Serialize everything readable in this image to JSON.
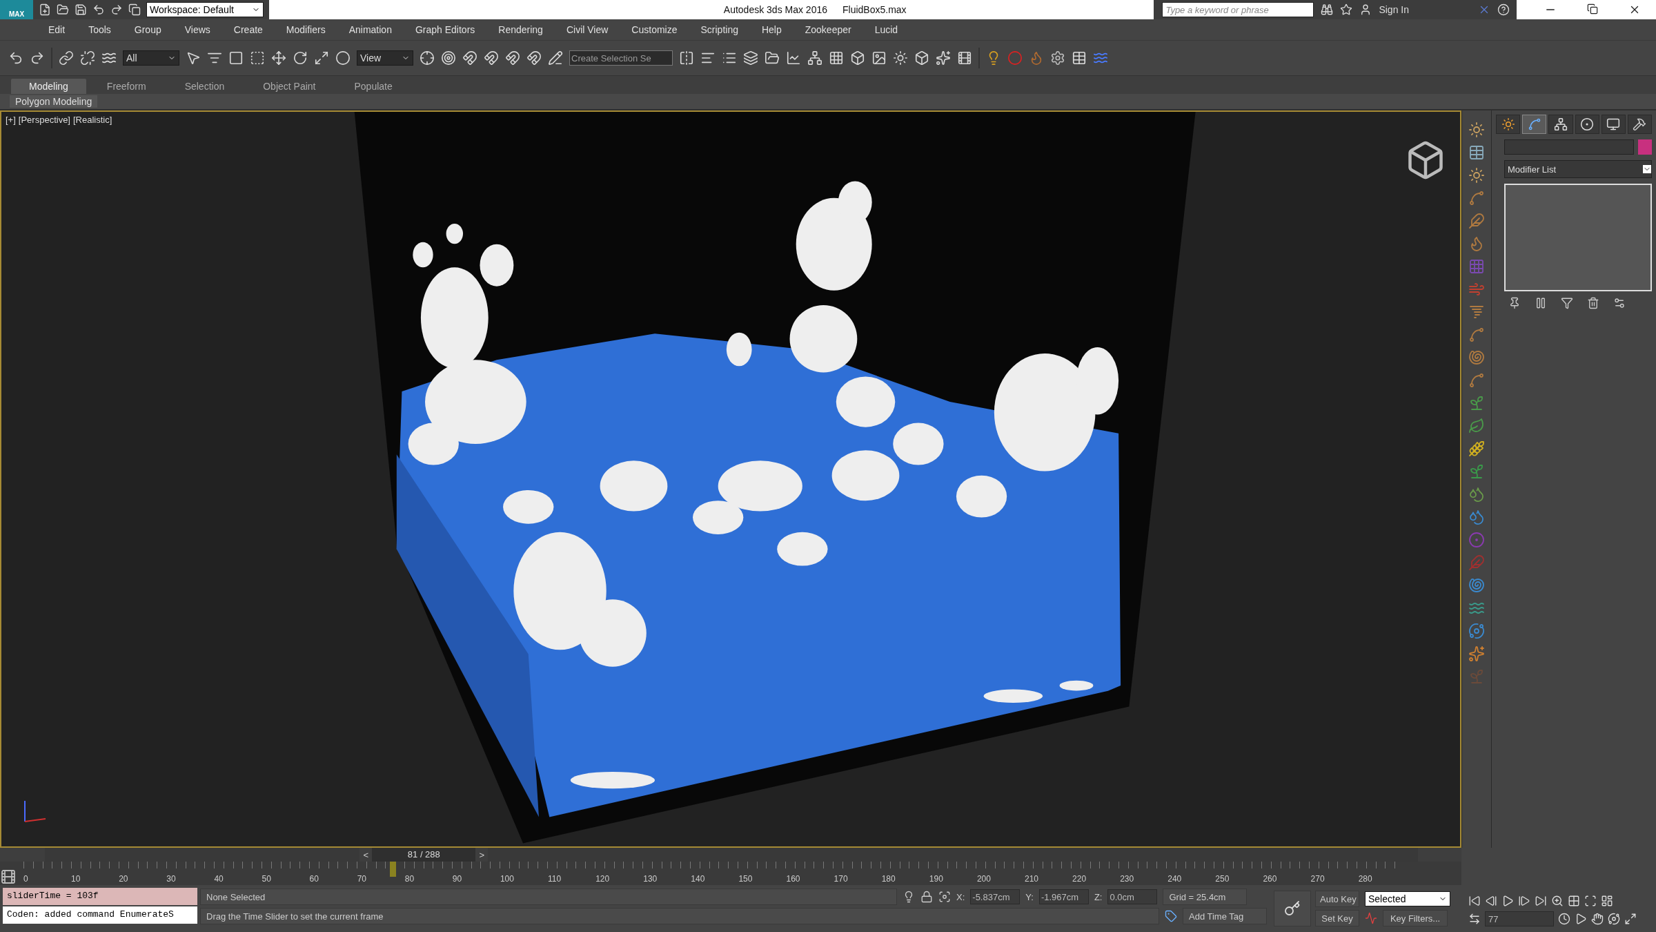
{
  "title_bar": {
    "app_badge": "MAX",
    "workspace": "Workspace: Default",
    "title": "Autodesk 3ds Max 2016",
    "file_name": "FluidBox5.max",
    "search": {
      "placeholder": "Type a keyword or phrase"
    },
    "sign_in": "Sign In"
  },
  "menu": [
    "Edit",
    "Tools",
    "Group",
    "Views",
    "Create",
    "Modifiers",
    "Animation",
    "Graph Editors",
    "Rendering",
    "Civil View",
    "Customize",
    "Scripting",
    "Help",
    "Zookeeper",
    "Lucid"
  ],
  "main_toolbar": {
    "selection_filter": "All",
    "reference_coordinate": "View",
    "named_selection": {
      "placeholder": "Create Selection Se"
    }
  },
  "ribbon": {
    "tabs": [
      {
        "label": "Modeling",
        "selected": true
      },
      {
        "label": "Freeform",
        "selected": false
      },
      {
        "label": "Selection",
        "selected": false
      },
      {
        "label": "Object Paint",
        "selected": false
      },
      {
        "label": "Populate",
        "selected": false
      }
    ],
    "panel_label": "Polygon Modeling"
  },
  "viewport": {
    "labels": [
      "[+]",
      "[Perspective]",
      "[Realistic]"
    ]
  },
  "command_panel": {
    "tabs": [
      {
        "kind": "create",
        "selected": false
      },
      {
        "kind": "modify",
        "selected": true
      },
      {
        "kind": "hierarchy",
        "selected": false
      },
      {
        "kind": "motion",
        "selected": false
      },
      {
        "kind": "display",
        "selected": false
      },
      {
        "kind": "utilities",
        "selected": false
      }
    ],
    "modifier_list": "Modifier List"
  },
  "timeline": {
    "slider": {
      "prev": "<",
      "label": "81 / 288",
      "next": ">"
    },
    "current_frame": {
      "level": 0.267
    },
    "ticks": [
      "0",
      "10",
      "20",
      "30",
      "40",
      "50",
      "60",
      "70",
      "80",
      "90",
      "100",
      "110",
      "120",
      "130",
      "140",
      "150",
      "160",
      "170",
      "180",
      "190",
      "200",
      "210",
      "220",
      "230",
      "240",
      "250",
      "260",
      "270",
      "280"
    ]
  },
  "status": {
    "listener": [
      "sliderTime = 103f",
      "Coden: added command EnumerateS"
    ],
    "selection": "None Selected",
    "prompt": "Drag the Time Slider to set the current frame",
    "coords": [
      {
        "label": "X:",
        "value": "-5.837cm"
      },
      {
        "label": "Y:",
        "value": "-1.967cm"
      },
      {
        "label": "Z:",
        "value": "0.0cm"
      }
    ],
    "grid": "Grid = 25.4cm",
    "add_time_tag": "Add Time Tag"
  },
  "anim": {
    "auto_key": "Auto Key",
    "key_mode": "Selected",
    "set_key": "Set Key",
    "key_filters": "Key Filters...",
    "frame": "77"
  }
}
